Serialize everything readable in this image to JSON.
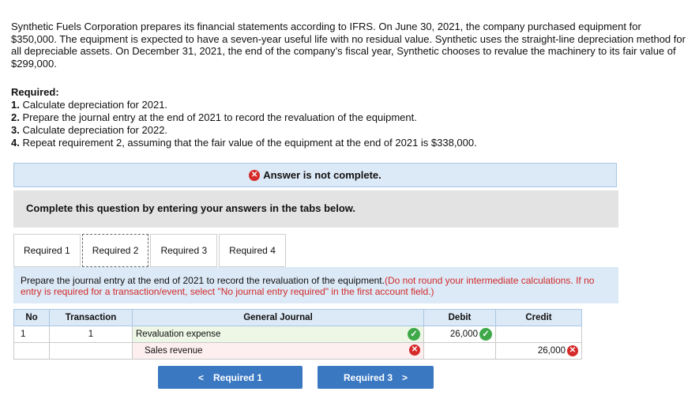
{
  "problem": {
    "text": "Synthetic Fuels Corporation prepares its financial statements according to IFRS. On June 30, 2021, the company purchased equipment for $350,000. The equipment is expected to have a seven-year useful life with no residual value. Synthetic uses the straight-line depreciation method for all depreciable assets. On December 31, 2021, the end of the company’s fiscal year, Synthetic chooses to revalue the machinery to its fair value of $299,000."
  },
  "required": {
    "heading": "Required:",
    "items": [
      {
        "num": "1.",
        "text": "Calculate depreciation for 2021."
      },
      {
        "num": "2.",
        "text": "Prepare the journal entry at the end of 2021 to record the revaluation of the equipment."
      },
      {
        "num": "3.",
        "text": "Calculate depreciation for 2022."
      },
      {
        "num": "4.",
        "text": "Repeat requirement 2, assuming that the fair value of the equipment at the end of 2021 is $338,000."
      }
    ]
  },
  "banner": {
    "text": "Answer is not complete.",
    "icon": "x-circle-icon"
  },
  "instructions": "Complete this question by entering your answers in the tabs below.",
  "tabs": [
    {
      "label": "Required 1",
      "active": false
    },
    {
      "label": "Required 2",
      "active": true
    },
    {
      "label": "Required 3",
      "active": false
    },
    {
      "label": "Required 4",
      "active": false
    }
  ],
  "panel": {
    "text": "Prepare the journal entry at the end of 2021 to record the revaluation of the equipment.",
    "note": "(Do not round your intermediate calculations. If no entry is required for a transaction/event, select \"No journal entry required\" in the first account field.)"
  },
  "journal": {
    "headers": {
      "no": "No",
      "transaction": "Transaction",
      "general_journal": "General Journal",
      "debit": "Debit",
      "credit": "Credit"
    },
    "rows": [
      {
        "no": "1",
        "transaction": "1",
        "account": "Revaluation expense",
        "debit": "26,000",
        "credit": "",
        "account_status": "correct",
        "debit_status": "correct"
      },
      {
        "no": "",
        "transaction": "",
        "account": "Sales revenue",
        "debit": "",
        "credit": "26,000",
        "account_status": "incorrect",
        "credit_status": "incorrect"
      }
    ]
  },
  "nav": {
    "prev_label": "Required 1",
    "next_label": "Required 3",
    "prev_glyph": "<",
    "next_glyph": ">"
  },
  "marks": {
    "check": "✓",
    "x": "✕"
  },
  "colors": {
    "accent": "#3a78c2",
    "correct": "#3fa94a",
    "incorrect": "#d62a2a",
    "panel_bg": "#dce9f6"
  }
}
